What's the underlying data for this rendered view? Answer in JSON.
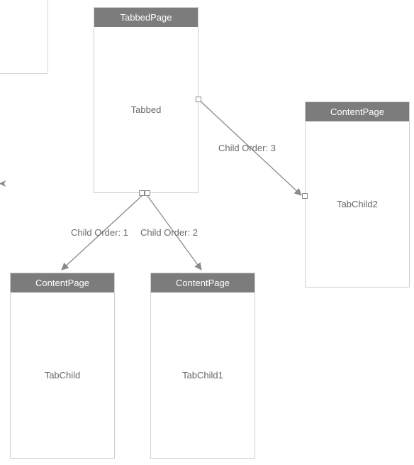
{
  "diagram": {
    "nodes": {
      "tabbed": {
        "header": "TabbedPage",
        "body": "Tabbed"
      },
      "child1": {
        "header": "ContentPage",
        "body": "TabChild"
      },
      "child2": {
        "header": "ContentPage",
        "body": "TabChild1"
      },
      "child3": {
        "header": "ContentPage",
        "body": "TabChild2"
      }
    },
    "edges": {
      "e1": {
        "label": "Child Order: 1"
      },
      "e2": {
        "label": "Child Order: 2"
      },
      "e3": {
        "label": "Child Order: 3"
      }
    }
  }
}
